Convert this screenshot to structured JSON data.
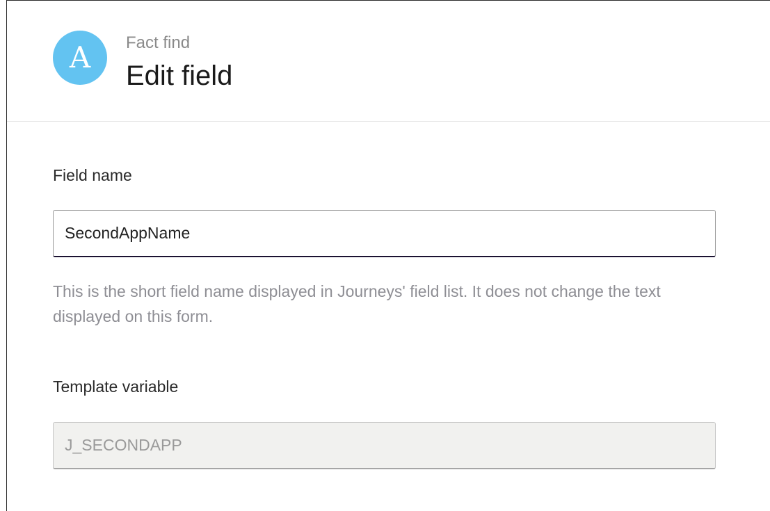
{
  "header": {
    "avatar_letter": "A",
    "eyebrow": "Fact find",
    "title": "Edit field"
  },
  "form": {
    "field_name": {
      "label": "Field name",
      "value": "SecondAppName",
      "help": "This is the short field name displayed in Journeys' field list. It does not change the text displayed on this form."
    },
    "template_variable": {
      "label": "Template variable",
      "value": "J_SECONDAPP",
      "disabled": true
    }
  },
  "colors": {
    "avatar": "#63c3f1",
    "input_focus_border": "#1b1231",
    "help_text": "#8e8e94",
    "disabled_bg": "#f1f1ef"
  }
}
